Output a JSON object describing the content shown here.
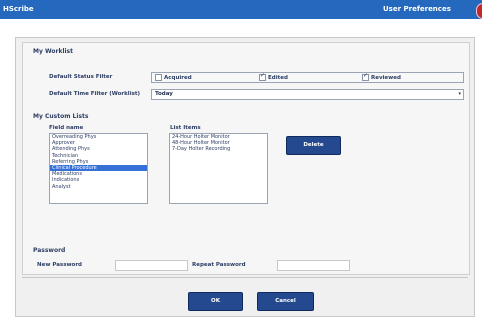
{
  "titlebar": {
    "app_name": "HScribe",
    "window_title": "User Preferences"
  },
  "worklist": {
    "section_title": "My Worklist",
    "status_filter_label": "Default Status Filter",
    "status_options": [
      {
        "label": "Acquired",
        "checked": false
      },
      {
        "label": "Edited",
        "checked": true
      },
      {
        "label": "Reviewed",
        "checked": true
      }
    ],
    "time_filter_label": "Default Time Filter (Worklist)",
    "time_filter_value": "Today"
  },
  "custom_lists": {
    "section_title": "My Custom Lists",
    "field_name_header": "Field name",
    "list_items_header": "List Items",
    "fields": [
      "Overreading Phys",
      "Approver",
      "Attending Phys",
      "Technician",
      "Referring Phys",
      "Clinical Procedure",
      "Medications",
      "Indications",
      "Analyst"
    ],
    "selected_field": "Clinical Procedure",
    "list_items": [
      "24-Hour Holter Monitor",
      "48-Hour Holter Monitor",
      "7-Day Holter Recording"
    ],
    "delete_label": "Delete"
  },
  "password": {
    "section_title": "Password",
    "new_label": "New Password",
    "new_value": "",
    "repeat_label": "Repeat Password",
    "repeat_value": ""
  },
  "footer": {
    "ok_label": "OK",
    "cancel_label": "Cancel"
  }
}
